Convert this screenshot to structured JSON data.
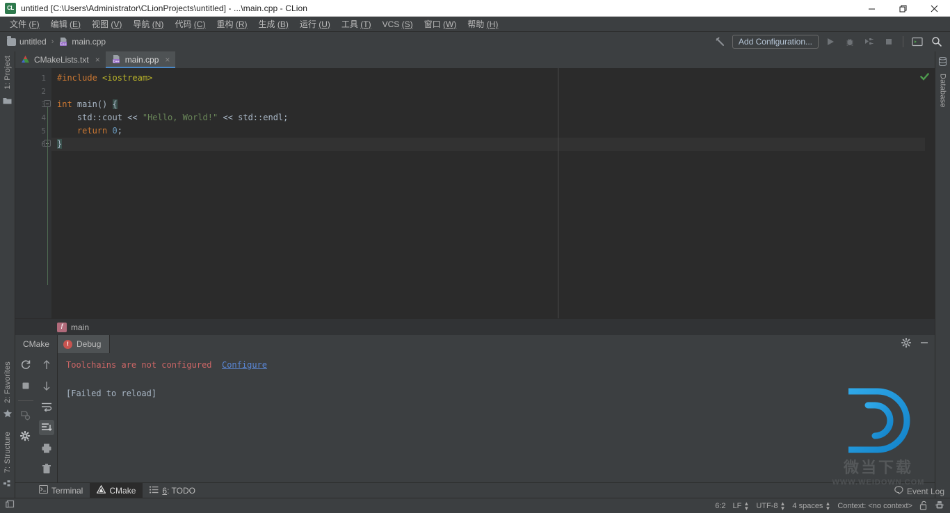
{
  "window": {
    "title": "untitled [C:\\Users\\Administrator\\CLionProjects\\untitled] - ...\\main.cpp - CLion",
    "logo_text": "CL",
    "minimize_label": "Minimize",
    "maximize_label": "Restore",
    "close_label": "Close"
  },
  "menubar": {
    "items": [
      {
        "label": "文件",
        "mnemonic": "(F)"
      },
      {
        "label": "编辑",
        "mnemonic": "(E)"
      },
      {
        "label": "视图",
        "mnemonic": "(V)"
      },
      {
        "label": "导航",
        "mnemonic": "(N)"
      },
      {
        "label": "代码",
        "mnemonic": "(C)"
      },
      {
        "label": "重构",
        "mnemonic": "(R)"
      },
      {
        "label": "生成",
        "mnemonic": "(B)"
      },
      {
        "label": "运行",
        "mnemonic": "(U)"
      },
      {
        "label": "工具",
        "mnemonic": "(T)"
      },
      {
        "label": "VCS",
        "mnemonic": "(S)"
      },
      {
        "label": "窗口",
        "mnemonic": "(W)"
      },
      {
        "label": "帮助",
        "mnemonic": "(H)"
      }
    ]
  },
  "navbar": {
    "breadcrumb": [
      {
        "label": "untitled",
        "icon": "folder-icon"
      },
      {
        "label": "main.cpp",
        "icon": "cpp-file-icon"
      }
    ],
    "separator": "›",
    "build_icon": "hammer-icon",
    "add_configuration": "Add Configuration...",
    "run_icon": "run-icon",
    "debug_icon": "debug-icon",
    "run_with_coverage_icon": "run-with-coverage-icon",
    "stop_icon": "stop-icon",
    "terminal_icon": "terminal-icon",
    "search_icon": "search-icon"
  },
  "editor": {
    "tabs": [
      {
        "label": "CMakeLists.txt",
        "icon": "cmake-file-icon",
        "active": false,
        "close": "×"
      },
      {
        "label": "main.cpp",
        "icon": "cpp-file-icon",
        "active": true,
        "close": "×"
      }
    ],
    "line_numbers": [
      "1",
      "2",
      "3",
      "4",
      "5",
      "6"
    ],
    "lines": [
      {
        "n": 1,
        "segments": [
          {
            "t": "#include ",
            "c": "kw"
          },
          {
            "t": "<iostream>",
            "c": "inc"
          }
        ]
      },
      {
        "n": 2,
        "segments": []
      },
      {
        "n": 3,
        "segments": [
          {
            "t": "int ",
            "c": "kw"
          },
          {
            "t": "main",
            "c": "def"
          },
          {
            "t": "()",
            "c": "def"
          },
          {
            "t": " ",
            "c": "def"
          },
          {
            "t": "{",
            "c": "brace-hl"
          }
        ]
      },
      {
        "n": 4,
        "segments": [
          {
            "t": "    std::cout ",
            "c": "def"
          },
          {
            "t": "<< ",
            "c": "def"
          },
          {
            "t": "\"Hello, World!\"",
            "c": "str"
          },
          {
            "t": " << std::endl;",
            "c": "def"
          }
        ]
      },
      {
        "n": 5,
        "segments": [
          {
            "t": "    return ",
            "c": "kw"
          },
          {
            "t": "0",
            "c": "num"
          },
          {
            "t": ";",
            "c": "def"
          }
        ]
      },
      {
        "n": 6,
        "segments": [
          {
            "t": "}",
            "c": "brace-hl"
          }
        ]
      }
    ],
    "inspection_status": "ok",
    "inspection_icon": "green-check-icon"
  },
  "sidebars": {
    "left_top": {
      "label": "1: Project",
      "mnemonic": "1",
      "icon": "project-folder-icon"
    },
    "left_bottom": [
      {
        "label": "2: Favorites",
        "mnemonic": "2",
        "icon": "star-icon"
      },
      {
        "label": "7: Structure",
        "mnemonic": "7",
        "icon": "structure-icon"
      }
    ],
    "right_top": {
      "label": "Database",
      "icon": "database-icon"
    }
  },
  "tool_window": {
    "breadcrumb": {
      "badge": "f",
      "label": "main"
    },
    "title": "CMake",
    "tab": {
      "label": "Debug",
      "icon": "error-icon",
      "icon_glyph": "!"
    },
    "settings_icon": "gear-icon",
    "hide_icon": "minimize-icon",
    "left_icons": [
      {
        "name": "reload-cmake-project-icon",
        "glyph": "refresh"
      },
      {
        "name": "stop-icon",
        "glyph": "stop"
      },
      {
        "name": "build-settings-icon",
        "glyph": "buildsettings"
      },
      {
        "name": "cmake-settings-icon",
        "glyph": "gear"
      }
    ],
    "right_icons": [
      {
        "name": "up-arrow-icon",
        "glyph": "up"
      },
      {
        "name": "down-arrow-icon",
        "glyph": "down"
      },
      {
        "name": "soft-wrap-icon",
        "glyph": "wrap"
      },
      {
        "name": "scroll-to-end-icon",
        "glyph": "scrollend",
        "selected": true
      },
      {
        "name": "print-icon",
        "glyph": "print"
      },
      {
        "name": "clear-all-icon",
        "glyph": "trash"
      }
    ],
    "console": {
      "error_text": "Toolchains are not configured",
      "link_text": "Configure",
      "status_text": "[Failed to reload]"
    }
  },
  "tool_tabs": [
    {
      "label": "Terminal",
      "icon": "terminal-icon",
      "active": false,
      "mnemonic": ""
    },
    {
      "label": "CMake",
      "icon": "cmake-icon",
      "active": true,
      "mnemonic": ""
    },
    {
      "label": "6: TODO",
      "icon": "todo-icon",
      "active": false,
      "mnemonic": "6"
    }
  ],
  "event_log": {
    "label": "Event Log",
    "icon": "event-log-icon"
  },
  "statusbar": {
    "toggle_icon": "toggle-toolwindows-icon",
    "caret_position": "6:2",
    "line_separator": "LF",
    "encoding": "UTF-8",
    "indent": "4 spaces",
    "context": "Context: <no context>",
    "lock_icon": "unlocked-icon",
    "inspector_icon": "inspection-widget-icon"
  },
  "watermark": {
    "logo_letter": "D",
    "cn_text": "微当下载",
    "url": "WWW.WEIDOWN.COM",
    "color": "#2196d9"
  }
}
